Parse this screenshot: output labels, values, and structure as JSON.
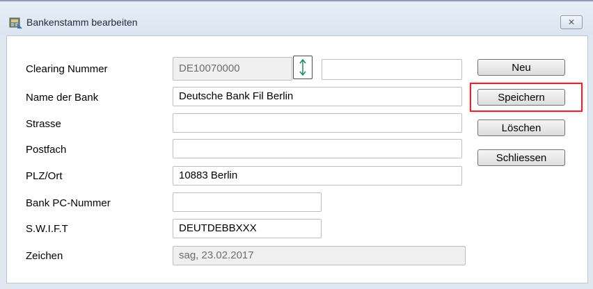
{
  "window": {
    "title": "Bankenstamm bearbeiten",
    "title_icon": "bank-icon",
    "close_symbol": "✕"
  },
  "form": {
    "clearing": {
      "label": "Clearing Nummer",
      "value": "DE10070000",
      "extra_value": ""
    },
    "name": {
      "label": "Name der Bank",
      "value": "Deutsche Bank Fil Berlin"
    },
    "strasse": {
      "label": "Strasse",
      "value": ""
    },
    "postfach": {
      "label": "Postfach",
      "value": ""
    },
    "plzort": {
      "label": "PLZ/Ort",
      "value": "10883 Berlin"
    },
    "pc": {
      "label": "Bank PC-Nummer",
      "value": ""
    },
    "swift": {
      "label": "S.W.I.F.T",
      "value": "DEUTDEBBXXX"
    },
    "zeichen": {
      "label": "Zeichen",
      "value": "sag, 23.02.2017"
    }
  },
  "buttons": {
    "neu": "Neu",
    "speichern": "Speichern",
    "loeschen": "Löschen",
    "schliessen": "Schliessen"
  },
  "colors": {
    "highlight": "#e0262f",
    "spinner_arrow": "#1a8a5a"
  }
}
